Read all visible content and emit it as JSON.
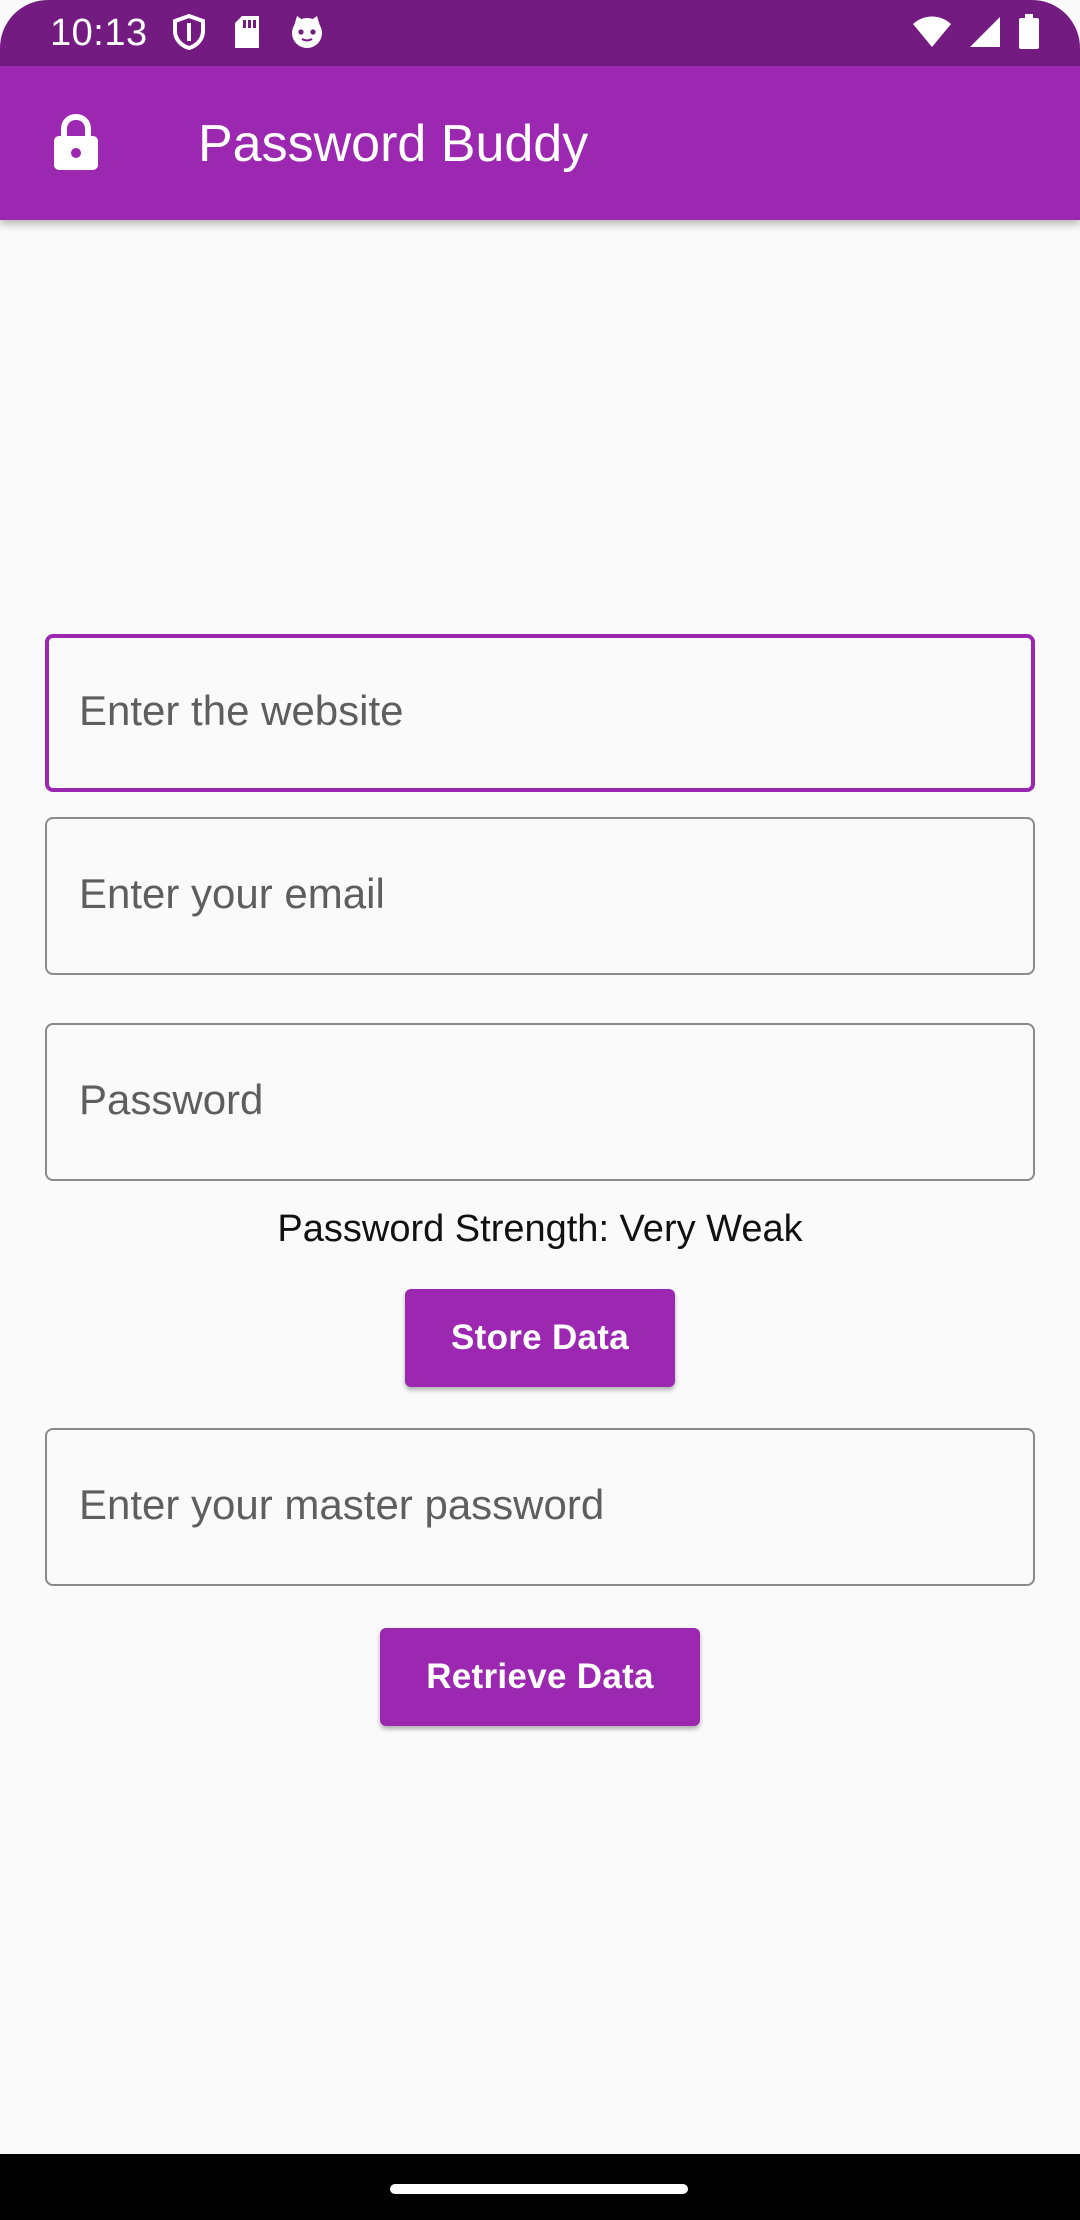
{
  "status_bar": {
    "time": "10:13",
    "left_icons": [
      "shield-icon",
      "sd-card-icon",
      "cat-face-icon"
    ],
    "right_icons": [
      "wifi-icon",
      "signal-icon",
      "battery-icon"
    ],
    "color": "#741b81"
  },
  "app_bar": {
    "icon": "lock-icon",
    "title": "Password Buddy",
    "color": "#9c27b0"
  },
  "form": {
    "website_field": {
      "placeholder": "Enter the website",
      "value": ""
    },
    "email_field": {
      "placeholder": "Enter your email",
      "value": ""
    },
    "password_field": {
      "placeholder": "Password",
      "value": ""
    },
    "strength_text": "Password Strength: Very Weak",
    "store_button": "Store Data",
    "master_password_field": {
      "placeholder": "Enter your master password",
      "value": ""
    },
    "retrieve_button": "Retrieve Data"
  },
  "accent_color": "#9c27b0"
}
